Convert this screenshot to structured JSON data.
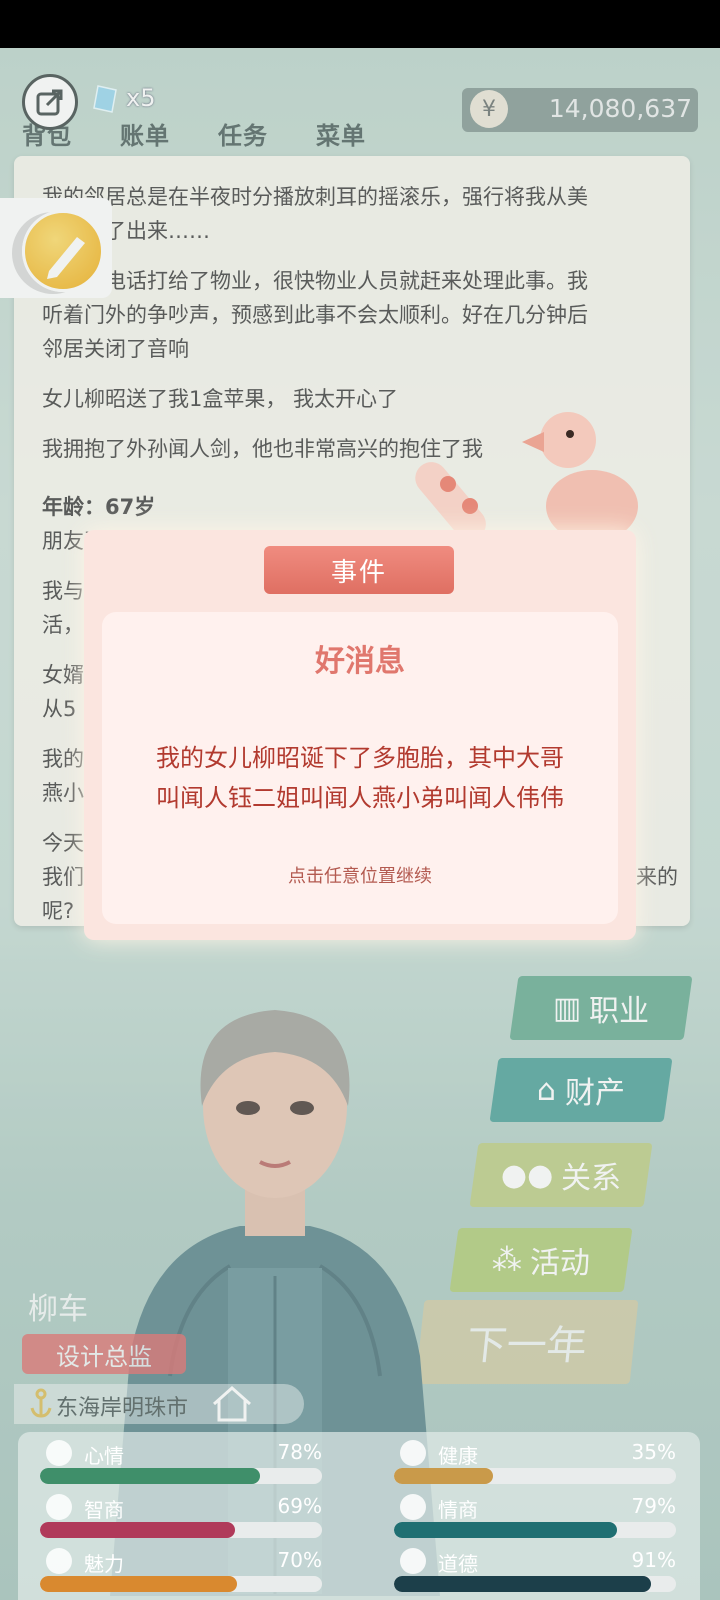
{
  "topbar": {
    "tabs": [
      "背包",
      "账单",
      "任务",
      "菜单"
    ],
    "gem_count": "x5",
    "currency_symbol": "¥",
    "money": "14,080,637"
  },
  "journal": {
    "lines": [
      "我的邻居总是在半夜时分播放刺耳的摇滚乐，强行将我从美",
      "梦中拽了出来……",
      "我一通电话打给了物业，很快物业人员就赶来处理此事。我",
      "听着门外的争吵声，预感到此事不会太顺利。好在几分钟后",
      "邻居关闭了音响",
      "女儿柳昭送了我1盒苹果， 我太开心了",
      "我拥抱了外孙闻人剑，他也非常高兴的抱住了我",
      "年龄：67岁",
      "朋友司",
      "我与",
      "活，",
      "女婿",
      "从5",
      "我的",
      "燕小",
      "今天",
      "我们",
      "来的",
      "呢?"
    ]
  },
  "dialog": {
    "header": "事件",
    "title": "好消息",
    "message_line1": "我的女儿柳昭诞下了多胞胎，其中大哥",
    "message_line2": "叫闻人钰二姐叫闻人燕小弟叫闻人伟伟",
    "hint": "点击任意位置继续"
  },
  "menu": {
    "job": "职业",
    "assets": "财产",
    "relations": "关系",
    "activities": "活动",
    "next_year": "下一年"
  },
  "character": {
    "name": "柳车",
    "job": "设计总监",
    "location": "东海岸明珠市"
  },
  "stats": [
    {
      "label": "心情",
      "value": "78%",
      "pct": 78,
      "color": "#3f8f6a",
      "icon": "smile-icon"
    },
    {
      "label": "健康",
      "value": "35%",
      "pct": 35,
      "color": "#c99a4a",
      "icon": "heart-icon"
    },
    {
      "label": "智商",
      "value": "69%",
      "pct": 69,
      "color": "#b03a5a",
      "icon": "bulb-icon"
    },
    {
      "label": "情商",
      "value": "79%",
      "pct": 79,
      "color": "#1f6f72",
      "icon": "apple-icon"
    },
    {
      "label": "魅力",
      "value": "70%",
      "pct": 70,
      "color": "#d9892f",
      "icon": "sparkle-icon"
    },
    {
      "label": "道德",
      "value": "91%",
      "pct": 91,
      "color": "#1c3f4a",
      "icon": "balance-icon"
    }
  ]
}
